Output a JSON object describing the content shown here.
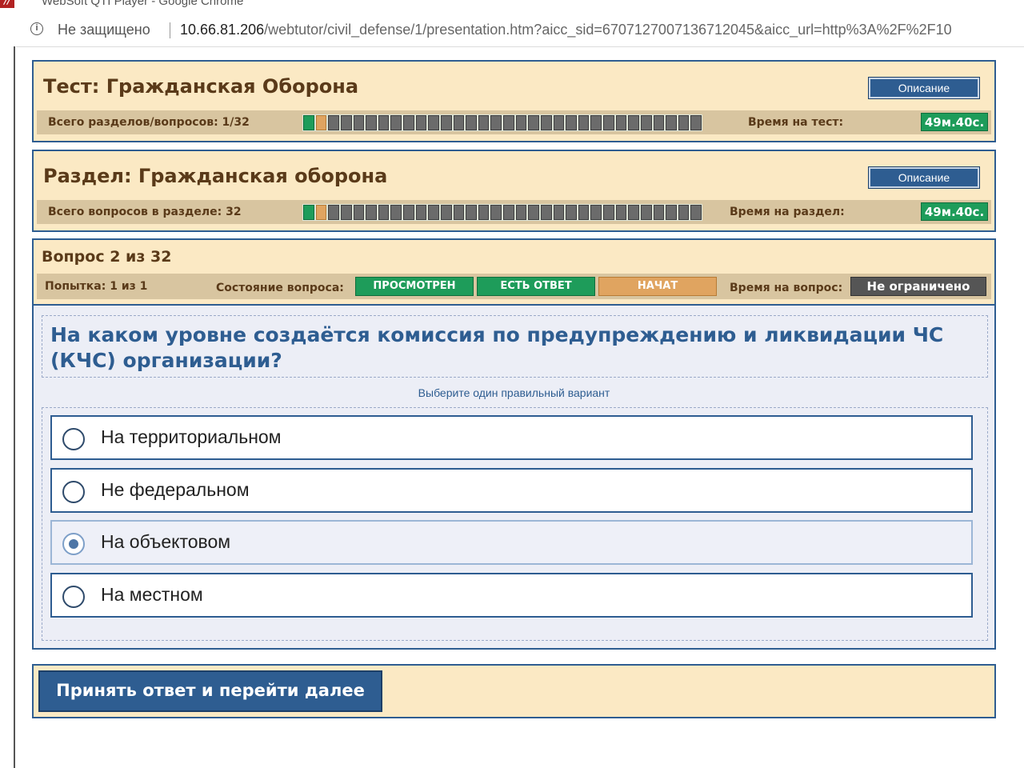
{
  "window": {
    "title": "WebSoft QTI Player - Google Chrome",
    "logo": "//"
  },
  "address_bar": {
    "security_label": "Не защищено",
    "url_host": "10.66.81.206",
    "url_path": "/webtutor/civil_defense/1/presentation.htm?aicc_sid=6707127007136712045&aicc_url=http%3A%2F%2F10"
  },
  "test": {
    "title": "Тест: Гражданская Оборона",
    "description_button": "Описание",
    "progress_label": "Всего разделов/вопросов: 1/32",
    "time_label": "Время на тест:",
    "time_value": "49м.40с.",
    "progress": {
      "total": 32,
      "done": 1,
      "current": 2
    }
  },
  "section": {
    "title": "Раздел: Гражданская оборона",
    "description_button": "Описание",
    "progress_label": "Всего вопросов в разделе: 32",
    "time_label": "Время на раздел:",
    "time_value": "49м.40с.",
    "progress": {
      "total": 32,
      "done": 1,
      "current": 2
    }
  },
  "question": {
    "number_label": "Вопрос 2 из 32",
    "attempt_label": "Попытка: 1 из 1",
    "state_label": "Состояние вопроса:",
    "states": [
      {
        "label": "ПРОСМОТРЕН",
        "color": "#1e9c5a"
      },
      {
        "label": "ЕСТЬ ОТВЕТ",
        "color": "#1e9c5a"
      },
      {
        "label": "НАЧАТ",
        "color": "#e0a460"
      }
    ],
    "time_label": "Время на вопрос:",
    "time_value": "Не ограничено",
    "text": "На каком уровне создаётся комиссия по предупреждению и ликвидации ЧС (КЧС) организации?",
    "instruction": "Выберите один правильный вариант",
    "answers": [
      {
        "label": "На территориальном",
        "selected": false
      },
      {
        "label": "Не федеральном",
        "selected": false
      },
      {
        "label": "На объектовом",
        "selected": true
      },
      {
        "label": "На местном",
        "selected": false
      }
    ]
  },
  "footer": {
    "submit_button": "Принять ответ и перейти далее"
  },
  "colors": {
    "panel_border": "#2e5d91",
    "panel_bg": "#fbe9c4",
    "bar_bg": "#d8c5a0",
    "accent_blue": "#2e5d91",
    "green": "#1e9c5a",
    "orange": "#e0a460"
  }
}
